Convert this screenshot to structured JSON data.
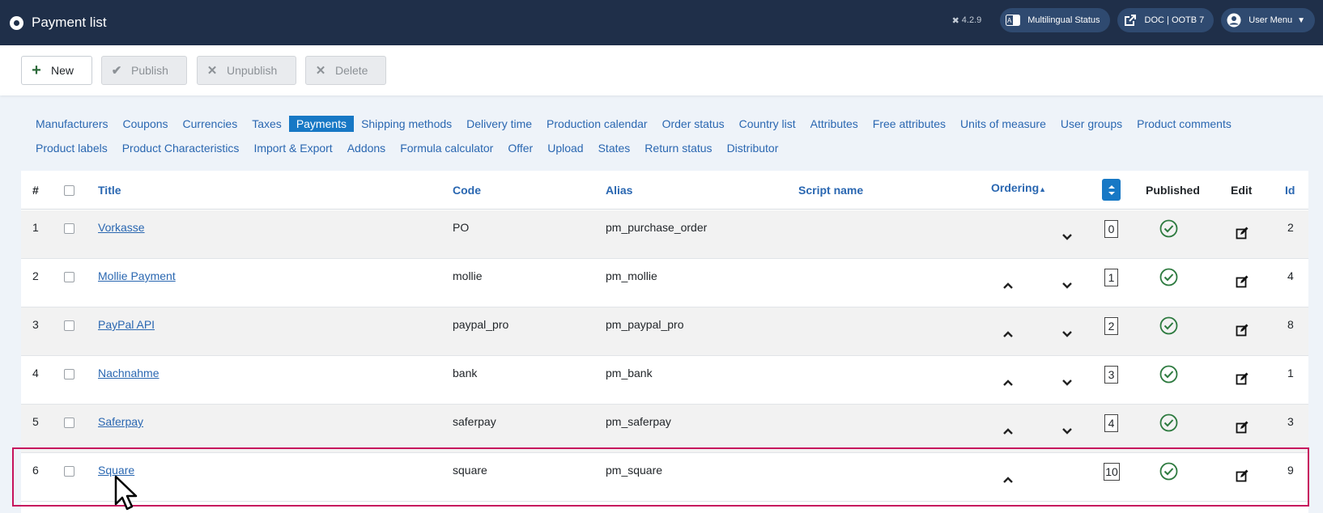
{
  "header": {
    "title": "Payment list",
    "version": "4.2.9",
    "pills": [
      {
        "label": "Multilingual Status",
        "icon": "language-icon"
      },
      {
        "label": "DOC | OOTB 7",
        "icon": "external-link-icon"
      },
      {
        "label": "User Menu",
        "icon": "user-icon"
      }
    ]
  },
  "toolbar": {
    "new_label": "New",
    "publish_label": "Publish",
    "unpublish_label": "Unpublish",
    "delete_label": "Delete"
  },
  "submenu": {
    "row1": [
      "Manufacturers",
      "Coupons",
      "Currencies",
      "Taxes",
      "Payments",
      "Shipping methods",
      "Delivery time",
      "Production calendar",
      "Order status",
      "Country list",
      "Attributes",
      "Free attributes",
      "Units of measure",
      "User groups",
      "Product comments"
    ],
    "row2": [
      "Product labels",
      "Product Characteristics",
      "Import & Export",
      "Addons",
      "Formula calculator",
      "Offer",
      "Upload",
      "States",
      "Return status",
      "Distributor"
    ],
    "active": "Payments"
  },
  "table": {
    "headers": {
      "num": "#",
      "title": "Title",
      "code": "Code",
      "alias": "Alias",
      "script": "Script name",
      "ordering": "Ordering",
      "published": "Published",
      "edit": "Edit",
      "id": "Id"
    },
    "rows": [
      {
        "num": "1",
        "title": "Vorkasse",
        "code": "PO",
        "alias": "pm_purchase_order",
        "order": "0",
        "id": "2",
        "up": false,
        "down": true
      },
      {
        "num": "2",
        "title": "Mollie Payment",
        "code": "mollie",
        "alias": "pm_mollie",
        "order": "1",
        "id": "4",
        "up": true,
        "down": true
      },
      {
        "num": "3",
        "title": "PayPal API",
        "code": "paypal_pro",
        "alias": "pm_paypal_pro",
        "order": "2",
        "id": "8",
        "up": true,
        "down": true
      },
      {
        "num": "4",
        "title": "Nachnahme",
        "code": "bank",
        "alias": "pm_bank",
        "order": "3",
        "id": "1",
        "up": true,
        "down": true
      },
      {
        "num": "5",
        "title": "Saferpay",
        "code": "saferpay",
        "alias": "pm_saferpay",
        "order": "4",
        "id": "3",
        "up": true,
        "down": true
      },
      {
        "num": "6",
        "title": "Square",
        "code": "square",
        "alias": "pm_square",
        "order": "10",
        "id": "9",
        "up": true,
        "down": false
      }
    ]
  },
  "colors": {
    "header_bg": "#1f2f49",
    "link": "#2a67b1",
    "active": "#1778c5",
    "published": "#2d7a3f",
    "highlight": "#c7135d"
  }
}
